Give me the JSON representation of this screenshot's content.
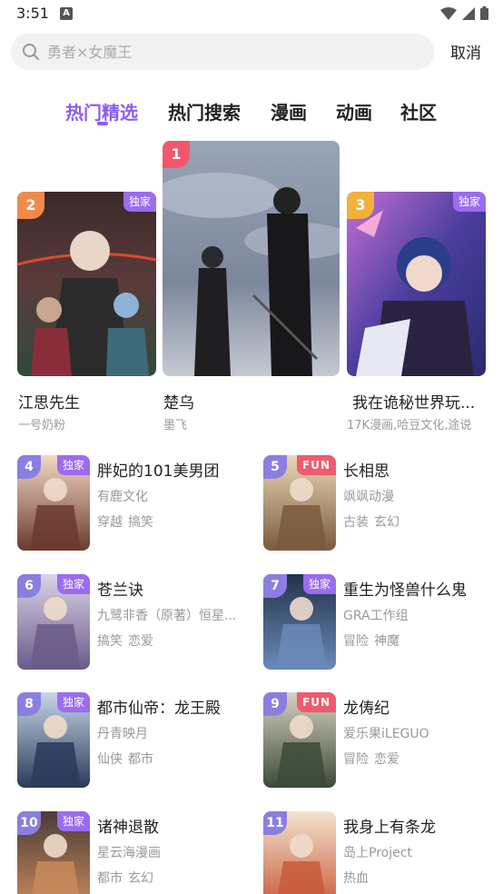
{
  "status": {
    "time": "3:51",
    "a_label": "A"
  },
  "search": {
    "placeholder": "勇者×女魔王",
    "cancel": "取消"
  },
  "tabs": [
    "热门精选",
    "热门搜索",
    "漫画",
    "动画",
    "社区"
  ],
  "top3": [
    {
      "rank": "1",
      "title": "楚乌",
      "subtitle": "墨飞",
      "badge": ""
    },
    {
      "rank": "2",
      "title": "江思先生",
      "subtitle": "一号奶粉",
      "badge": "独家"
    },
    {
      "rank": "3",
      "title": "我在诡秘世界玩...",
      "subtitle": "17K漫画,哈豆文化,途说",
      "badge": "独家"
    }
  ],
  "list": [
    {
      "rank": "4",
      "badge": "独家",
      "title": "胖妃的101美男团",
      "author": "有鹿文化",
      "tags": [
        "穿越",
        "搞笑"
      ]
    },
    {
      "rank": "5",
      "badge": "FUN",
      "title": "长相思",
      "author": "飒飒动漫",
      "tags": [
        "古装",
        "玄幻"
      ]
    },
    {
      "rank": "6",
      "badge": "独家",
      "title": "苍兰诀",
      "author": "九鹭非香（原著）恒星...",
      "tags": [
        "搞笑",
        "恋爱"
      ]
    },
    {
      "rank": "7",
      "badge": "独家",
      "title": "重生为怪兽什么鬼",
      "author": "GRA工作组",
      "tags": [
        "冒险",
        "神魔"
      ]
    },
    {
      "rank": "8",
      "badge": "独家",
      "title": "都市仙帝：龙王殿",
      "author": "丹青映月",
      "tags": [
        "仙侠",
        "都市"
      ]
    },
    {
      "rank": "9",
      "badge": "FUN",
      "title": "龙俦纪",
      "author": "爱乐果iLEGUO",
      "tags": [
        "冒险",
        "恋爱"
      ]
    },
    {
      "rank": "10",
      "badge": "独家",
      "title": "诸神退散",
      "author": "星云海漫画",
      "tags": [
        "都市",
        "玄幻"
      ]
    },
    {
      "rank": "11",
      "badge": "",
      "title": "我身上有条龙",
      "author": "岛上Project",
      "tags": [
        "热血"
      ]
    }
  ]
}
